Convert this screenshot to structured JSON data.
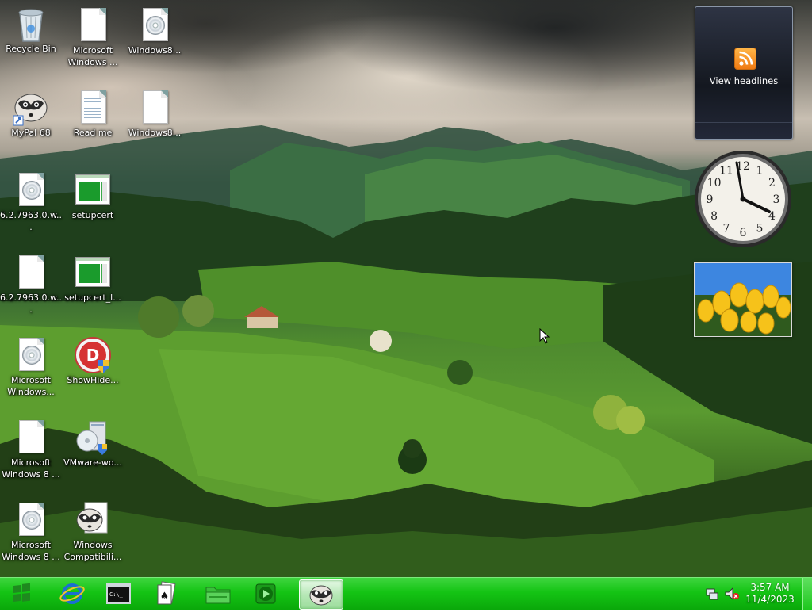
{
  "desktop": {
    "icons": [
      {
        "id": "recycle-bin",
        "label": "Recycle Bin",
        "icon": "recycle-bin-icon"
      },
      {
        "id": "microsoft-windows-1",
        "label": "Microsoft Windows ...",
        "icon": "document-icon"
      },
      {
        "id": "windows8-1",
        "label": "Windows8...",
        "icon": "disc-image-icon"
      },
      {
        "id": "mypal-68",
        "label": "MyPal 68",
        "icon": "mypal-raccoon-icon"
      },
      {
        "id": "read-me",
        "label": "Read me",
        "icon": "text-document-icon"
      },
      {
        "id": "windows8-2",
        "label": "Windows8...",
        "icon": "document-icon"
      },
      {
        "id": "iso-6279630-a",
        "label": "6.2.7963.0.w...",
        "icon": "disc-image-icon"
      },
      {
        "id": "setupcert",
        "label": "setupcert",
        "icon": "application-window-icon"
      },
      {
        "id": "iso-6279630-b",
        "label": "6.2.7963.0.w...",
        "icon": "document-icon"
      },
      {
        "id": "setupcert-l",
        "label": "setupcert_l...",
        "icon": "application-window-icon"
      },
      {
        "id": "microsoft-windows-2",
        "label": "Microsoft Windows...",
        "icon": "disc-image-icon"
      },
      {
        "id": "showhide",
        "label": "ShowHide...",
        "icon": "showhide-shield-icon"
      },
      {
        "id": "microsoft-windows-8-a",
        "label": "Microsoft Windows 8 ...",
        "icon": "document-icon"
      },
      {
        "id": "vmware-wo",
        "label": "VMware-wo...",
        "icon": "vmware-installer-icon"
      },
      {
        "id": "microsoft-windows-8-b",
        "label": "Microsoft Windows 8 ...",
        "icon": "disc-image-icon"
      },
      {
        "id": "windows-compat",
        "label": "Windows Compatibili...",
        "icon": "raccoon-document-icon"
      }
    ]
  },
  "gadgets": {
    "feed": {
      "label": "View headlines",
      "icon": "rss-feed-icon"
    },
    "clock": {
      "numerals": [
        "12",
        "1",
        "2",
        "3",
        "4",
        "5",
        "6",
        "7",
        "8",
        "9",
        "10",
        "11"
      ],
      "time": "3:57"
    },
    "slideshow": {
      "subject": "yellow tulips"
    }
  },
  "taskbar": {
    "start_icon": "windows-start-orb-icon",
    "pinned": [
      {
        "id": "internet-explorer",
        "icon": "internet-explorer-icon"
      },
      {
        "id": "command-prompt",
        "icon": "command-prompt-icon"
      },
      {
        "id": "solitaire",
        "icon": "solitaire-cards-icon"
      },
      {
        "id": "explorer",
        "icon": "file-explorer-icon"
      },
      {
        "id": "media-player",
        "icon": "media-player-icon"
      },
      {
        "id": "mypal",
        "icon": "mypal-raccoon-icon",
        "active": true
      }
    ],
    "tray": {
      "network_icon": "network-icon",
      "volume_icon": "volume-muted-icon",
      "time": "3:57 AM",
      "date": "11/4/2023"
    }
  },
  "colors": {
    "taskbar": "#14c414",
    "feed_bg": "#141820",
    "rss_orange": "#f07a12"
  }
}
